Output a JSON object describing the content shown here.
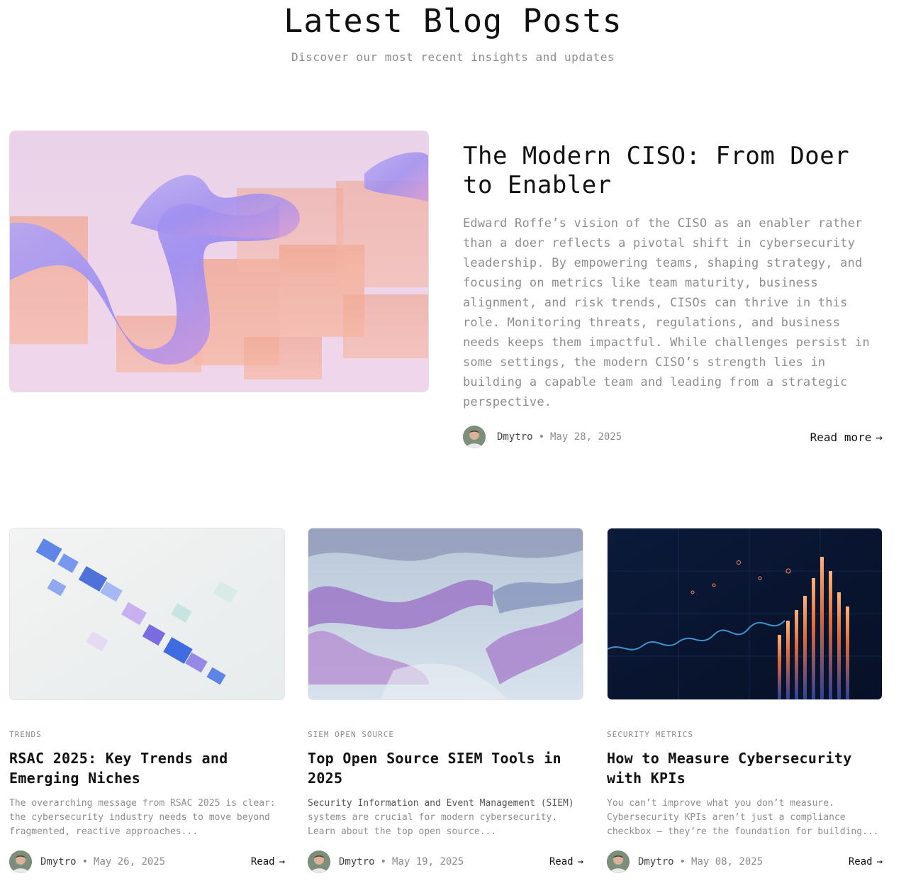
{
  "header": {
    "title": "Latest Blog Posts",
    "subtitle": "Discover our most recent insights and updates"
  },
  "featured": {
    "title": "The Modern CISO: From Doer to Enabler",
    "excerpt": "Edward Roffe’s vision of the CISO as an enabler rather than a doer reflects a pivotal shift in cybersecurity leadership. By empowering teams, shaping strategy, and focusing on metrics like team maturity, business alignment, and risk trends, CISOs can thrive in this role. Monitoring threats, regulations, and business needs keeps them impactful. While challenges persist in some settings, the modern CISO’s strength lies in building a capable team and leading from a strategic perspective.",
    "author": "Dmytro",
    "separator": "•",
    "date": "May 28, 2025",
    "read_more": "Read more",
    "arrow": "→"
  },
  "cards": [
    {
      "category": "TRENDS",
      "title": "RSAC 2025: Key Trends and Emerging Niches",
      "excerpt": "The overarching message from RSAC 2025 is clear: the cybersecurity industry needs to move beyond fragmented, reactive approaches...",
      "author": "Dmytro",
      "separator": "•",
      "date": "May 26, 2025",
      "read": "Read",
      "arrow": "→"
    },
    {
      "category": "SIEM OPEN SOURCE",
      "title": "Top Open Source SIEM Tools in 2025",
      "excerpt_strong": "Security Information and Event Management (SIEM)",
      "excerpt": " systems are crucial for modern cybersecurity. Learn about the top open source...",
      "author": "Dmytro",
      "separator": "•",
      "date": "May 19, 2025",
      "read": "Read",
      "arrow": "→"
    },
    {
      "category": "SECURITY METRICS",
      "title": "How to Measure Cybersecurity with KPIs",
      "excerpt": "You can’t improve what you don’t measure. Cybersecurity KPIs aren’t just a compliance checkbox — they’re the foundation for building...",
      "author": "Dmytro",
      "separator": "•",
      "date": "May 08, 2025",
      "read": "Read",
      "arrow": "→"
    }
  ],
  "colors": {
    "title": "#111111",
    "muted": "#8e8e8e",
    "featured_bg": "#ebd3e6",
    "card_dark_bg": "#0b1a3a"
  }
}
